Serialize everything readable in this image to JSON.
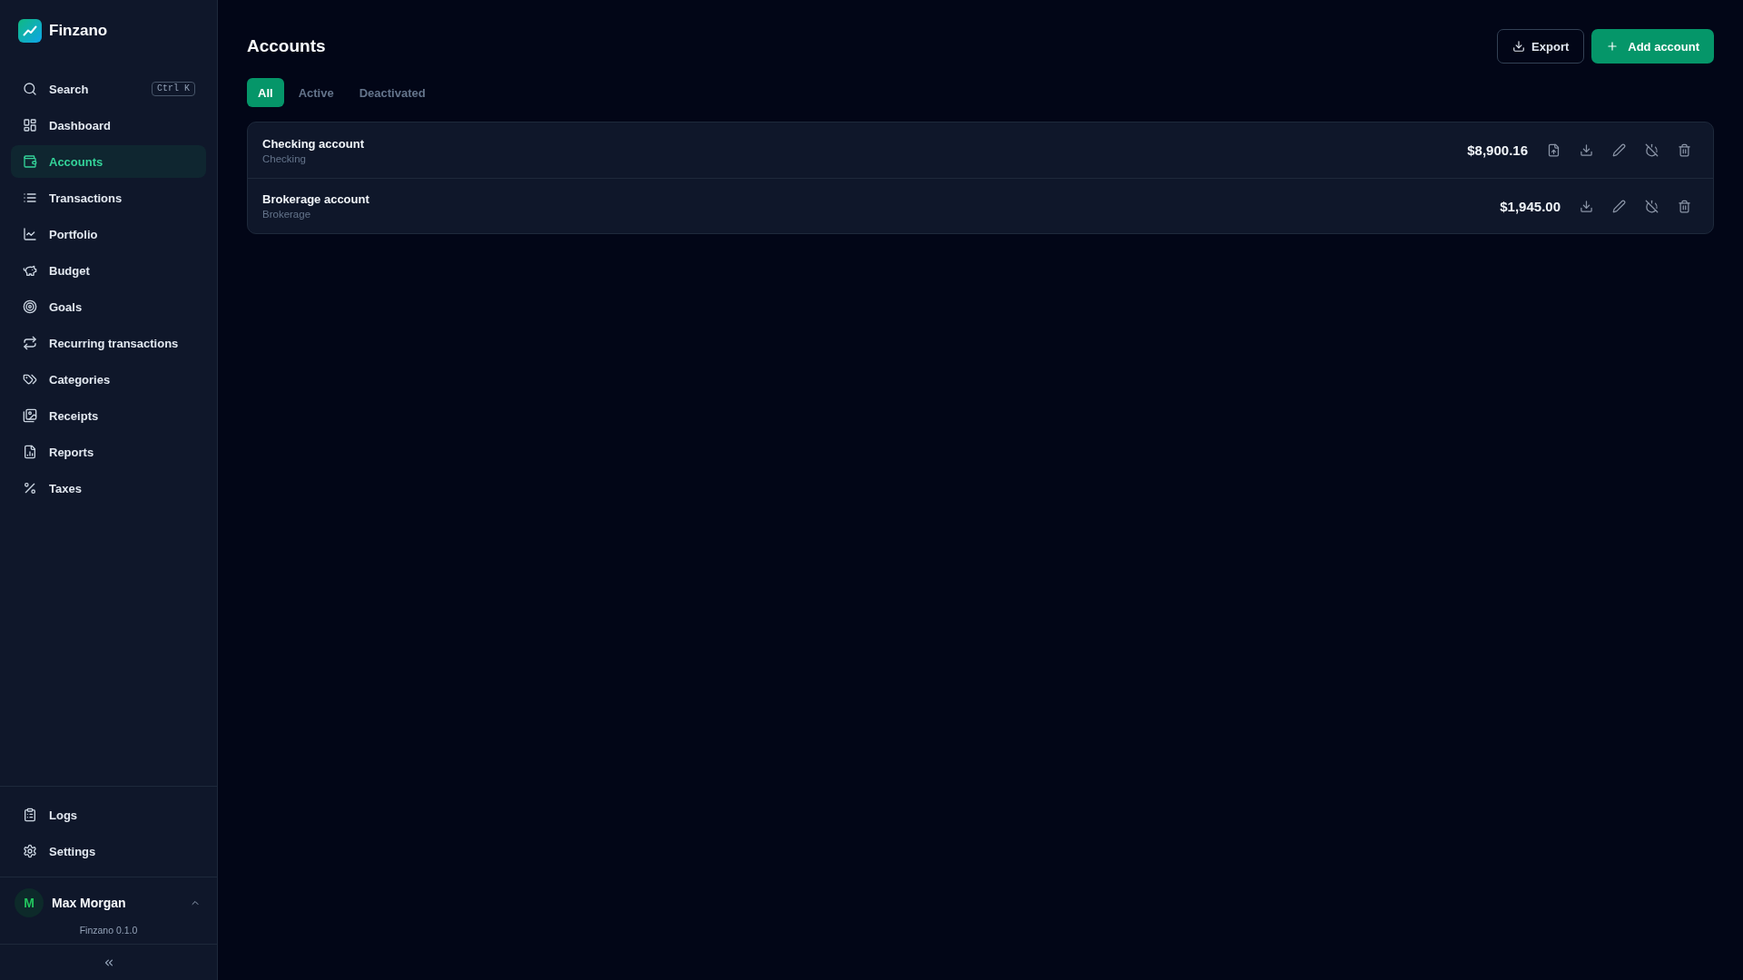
{
  "sidebar": {
    "brand": "Finzano",
    "search": {
      "label": "Search",
      "shortcut": "Ctrl K"
    },
    "nav_items": [
      {
        "label": "Dashboard",
        "selected": false
      },
      {
        "label": "Accounts",
        "selected": true
      },
      {
        "label": "Transactions",
        "selected": false
      },
      {
        "label": "Portfolio",
        "selected": false
      },
      {
        "label": "Budget",
        "selected": false
      },
      {
        "label": "Goals",
        "selected": false
      },
      {
        "label": "Recurring transactions",
        "selected": false
      },
      {
        "label": "Categories",
        "selected": false
      },
      {
        "label": "Receipts",
        "selected": false
      },
      {
        "label": "Reports",
        "selected": false
      },
      {
        "label": "Taxes",
        "selected": false
      }
    ],
    "footer_items": [
      {
        "label": "Logs",
        "selected": false
      },
      {
        "label": "Settings",
        "selected": false
      }
    ],
    "user": {
      "initial": "M",
      "name": "Max Morgan"
    },
    "version": "Finzano 0.1.0"
  },
  "page": {
    "title": "Accounts",
    "actions": [
      {
        "label": "Export",
        "kind": "secondary"
      },
      {
        "label": "Add account",
        "kind": "primary"
      }
    ],
    "tabs": [
      {
        "label": "All",
        "selected": true
      },
      {
        "label": "Active",
        "selected": false
      },
      {
        "label": "Deactivated",
        "selected": false
      }
    ],
    "accounts": [
      {
        "name": "Checking account",
        "type": "Checking",
        "balance": "$8,900.16",
        "actions": [
          {
            "kind": "upload"
          },
          {
            "kind": "download"
          },
          {
            "kind": "edit"
          },
          {
            "kind": "deactivate"
          },
          {
            "kind": "delete"
          }
        ]
      },
      {
        "name": "Brokerage account",
        "type": "Brokerage",
        "balance": "$1,945.00",
        "actions": [
          {
            "kind": "download"
          },
          {
            "kind": "edit"
          },
          {
            "kind": "deactivate"
          },
          {
            "kind": "delete"
          }
        ]
      }
    ]
  }
}
